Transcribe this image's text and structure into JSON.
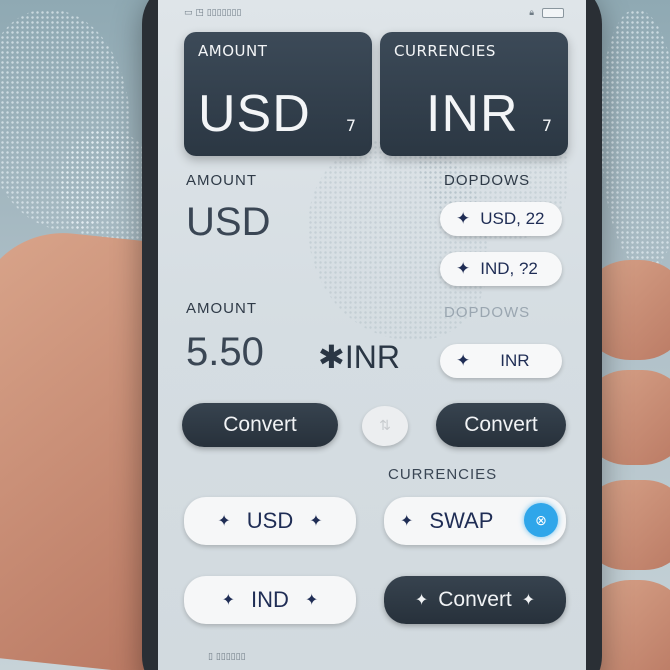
{
  "status_bar": {
    "left_text": "▭ ◳ ▯▯▯▯▯▯▯",
    "right_icon": "lock-icon"
  },
  "top_cards": {
    "amount": {
      "label": "AMOUNT",
      "currency": "USD",
      "suffix": "7"
    },
    "currencies": {
      "label": "CURRENCIES",
      "currency": "INR",
      "suffix": "7"
    }
  },
  "row2": {
    "amount_label": "AMOUNT",
    "amount_value": "USD",
    "dropdowns_label": "DOPDOWS",
    "dropdown_items": [
      {
        "icon": "star-icon",
        "label": "USD, 22"
      },
      {
        "icon": "star-icon",
        "label": "IND, ?2"
      }
    ]
  },
  "row3": {
    "amount_label": "AMOUNT",
    "amount_value": "5.50",
    "target_currency": "INR",
    "dropdowns_label": "DOPDOWS",
    "dropdown_item": {
      "icon": "star-icon",
      "label": "INR"
    }
  },
  "convert_buttons": {
    "left": "Convert",
    "right": "Convert"
  },
  "currencies_label": "CURRENCIES",
  "pills": {
    "usd": "USD",
    "swap": "SWAP",
    "ind": "IND",
    "convert": "Convert"
  },
  "home_text": "▯ ▯▯▯▯▯▯"
}
